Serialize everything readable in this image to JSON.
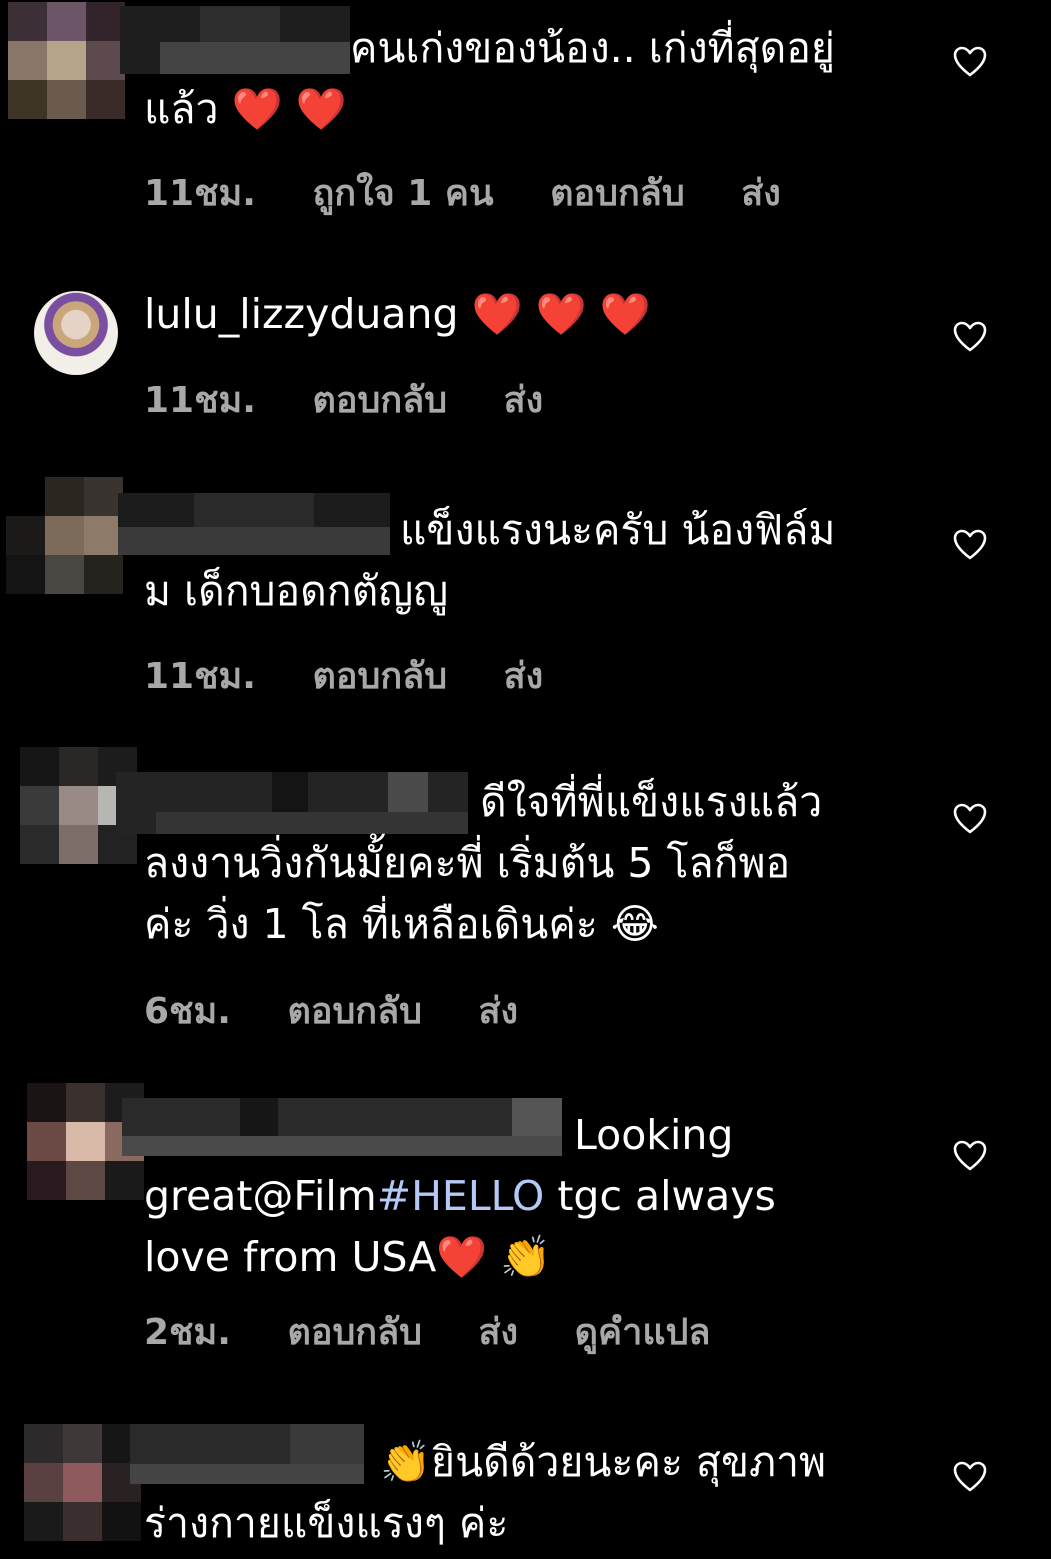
{
  "comments": [
    {
      "text_line1": "คนเก่งของน้อง.. เก่งที่สุดอยู่",
      "text_line2": "แล้ว ❤️ ❤️",
      "time": "11ชม.",
      "likes": "ถูกใจ 1 คน",
      "reply": "ตอบกลับ",
      "send": "ส่ง"
    },
    {
      "username": "lulu_lizzyduang",
      "text": "❤️ ❤️ ❤️",
      "time": "11ชม.",
      "reply": "ตอบกลับ",
      "send": "ส่ง"
    },
    {
      "text_line1": "แข็งแรงนะครับ น้องฟิล์ม",
      "text_line2": "ม เด็กบอดกตัญญู",
      "time": "11ชม.",
      "reply": "ตอบกลับ",
      "send": "ส่ง"
    },
    {
      "text_line1": "ดีใจที่พี่แข็งแรงแล้ว",
      "text_line2": "ลงงานวิ่งกันมั้ยคะพี่ เริ่มต้น 5 โลก็พอ",
      "text_line3": "ค่ะ วิ่ง 1 โล ที่เหลือเดินค่ะ 😂",
      "time": "6ชม.",
      "reply": "ตอบกลับ",
      "send": "ส่ง"
    },
    {
      "text_line1": "Looking",
      "text_line2_pre": "great@Film",
      "text_line2_tag": "#HELLO",
      "text_line2_post": " tgc always",
      "text_line3": "love from USA❤️ 👏",
      "time": "2ชม.",
      "reply": "ตอบกลับ",
      "send": "ส่ง",
      "translate": "ดูคำแปล"
    },
    {
      "text_line1": "👏ยินดีด้วยนะคะ สุขภาพ",
      "text_line2": "ร่างกายแข็งแรงๆ ค่ะ"
    }
  ],
  "icons": {
    "like": "heart-outline-icon"
  },
  "colors": {
    "background": "#000000",
    "meta": "#a8a8a8",
    "hashtag": "#b4c9f5"
  }
}
